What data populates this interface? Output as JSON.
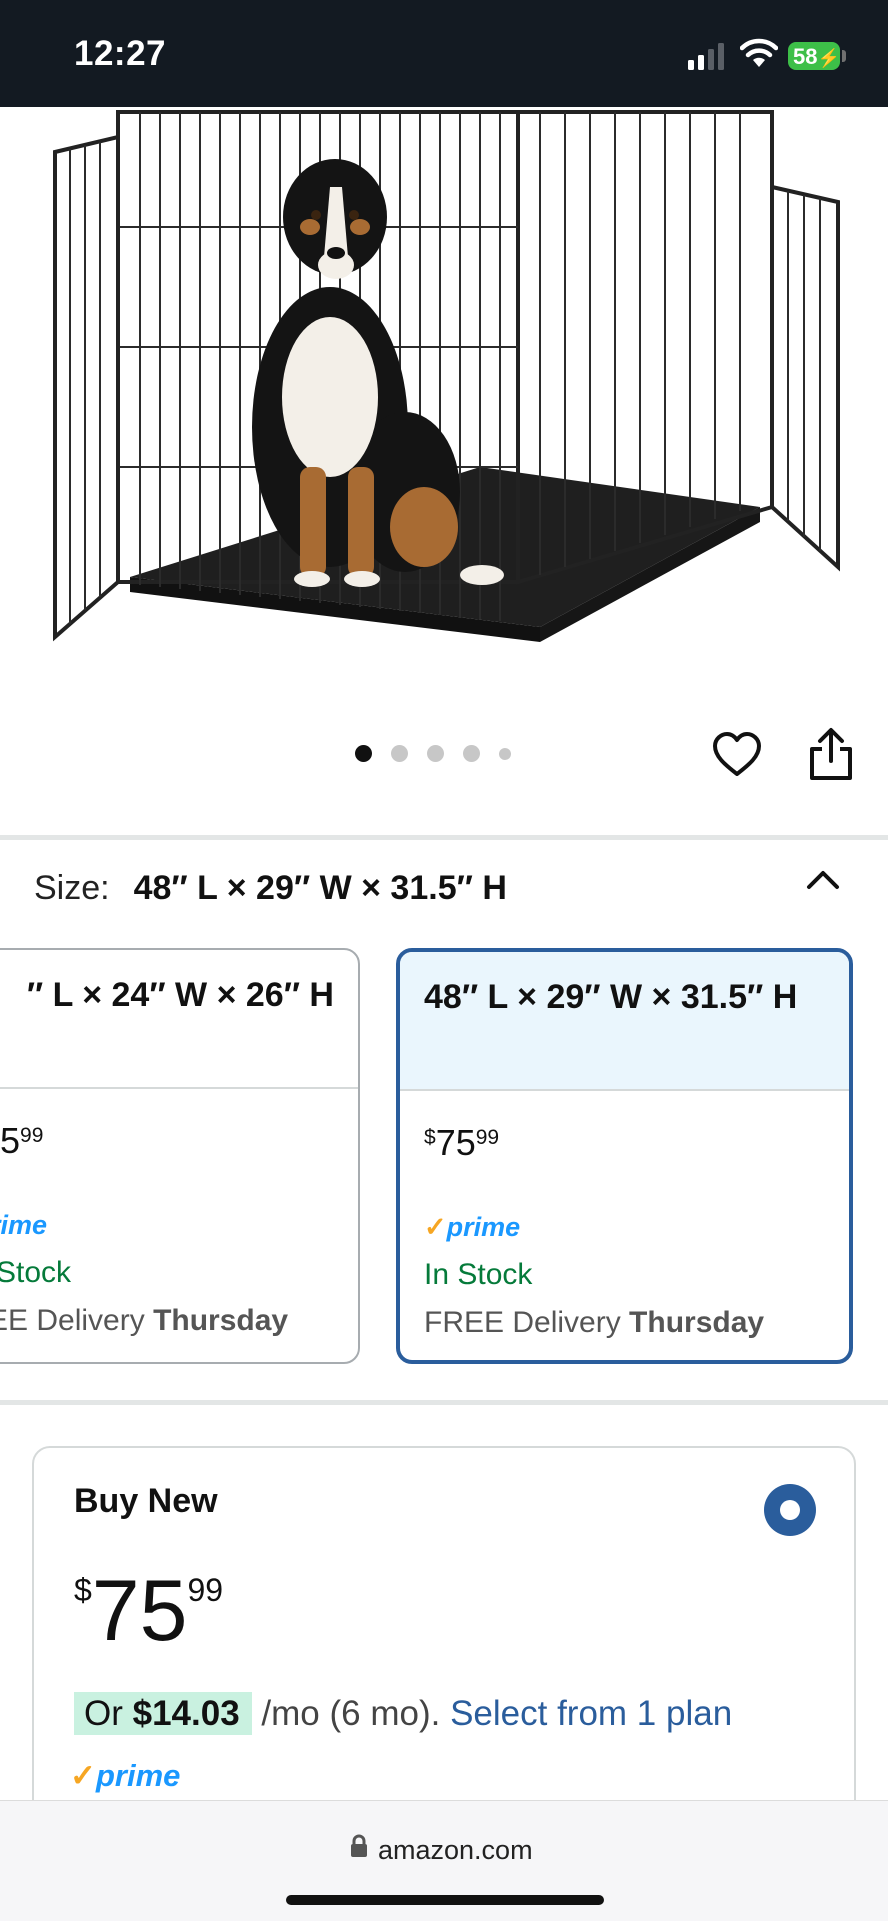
{
  "status_bar": {
    "time": "12:27",
    "battery": "58"
  },
  "gallery": {
    "image_alt": "Black wire dog crate with a Bernese mountain dog sitting inside",
    "active_dot": 1,
    "dot_count": 5
  },
  "size": {
    "label": "Size:",
    "value": "48″ L × 29″ W × 31.5″ H"
  },
  "options": [
    {
      "title": "″ L × 24″ W × 26″ H",
      "price_main": "5",
      "price_cents": "99",
      "prime": "rime",
      "stock": "Stock",
      "delivery_prefix": "EE Delivery",
      "delivery_day": "Thursday",
      "selected": false
    },
    {
      "title": "48″ L × 29″ W × 31.5″ H",
      "price_symbol": "$",
      "price_main": "75",
      "price_cents": "99",
      "prime": "prime",
      "stock": "In Stock",
      "delivery_prefix": "FREE Delivery",
      "delivery_day": "Thursday",
      "selected": true
    }
  ],
  "buy_box": {
    "title": "Buy New",
    "price_symbol": "$",
    "price_main": "75",
    "price_cents": "99",
    "installment_prefix": "Or",
    "installment_amount": "$14.03",
    "installment_terms": "/mo (6 mo).",
    "installment_link": "Select from 1 plan",
    "prime": "prime"
  },
  "browser": {
    "url": "amazon.com"
  },
  "colors": {
    "accent_blue": "#2a5d9c",
    "prime_blue": "#1a98ff",
    "stock_green": "#057a3a",
    "status_bar": "#131a22"
  }
}
